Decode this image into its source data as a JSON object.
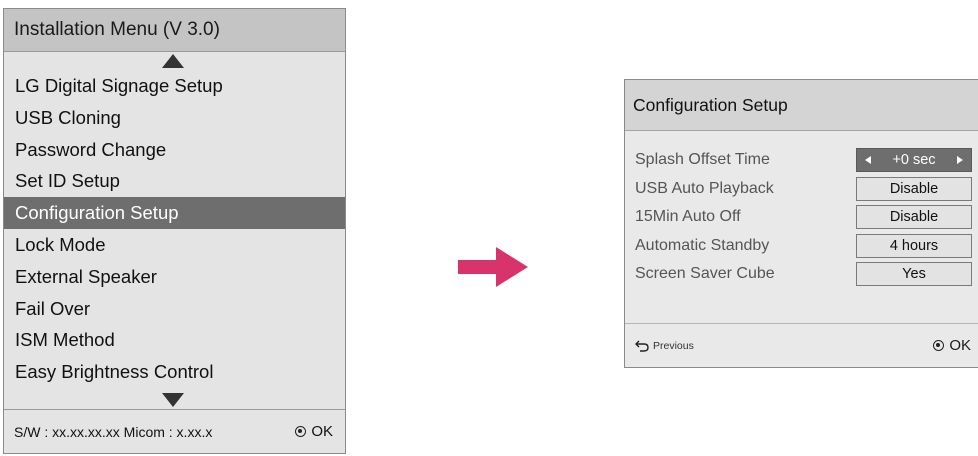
{
  "installation_menu": {
    "title": "Installation Menu (V 3.0)",
    "items": [
      {
        "label": "LG Digital Signage Setup",
        "selected": false
      },
      {
        "label": "USB Cloning",
        "selected": false
      },
      {
        "label": "Password Change",
        "selected": false
      },
      {
        "label": "Set ID Setup",
        "selected": false
      },
      {
        "label": "Configuration Setup",
        "selected": true
      },
      {
        "label": "Lock Mode",
        "selected": false
      },
      {
        "label": "External Speaker",
        "selected": false
      },
      {
        "label": "Fail Over",
        "selected": false
      },
      {
        "label": "ISM Method",
        "selected": false
      },
      {
        "label": "Easy Brightness Control",
        "selected": false
      }
    ],
    "footer": {
      "version_text": "S/W : xx.xx.xx.xx Micom : x.xx.x",
      "ok_label": "OK"
    }
  },
  "arrow_color": "#d9336b",
  "configuration_setup": {
    "title": "Configuration Setup",
    "rows": [
      {
        "label": "Splash Offset Time",
        "value": "+0 sec"
      },
      {
        "label": "USB Auto Playback",
        "value": "Disable"
      },
      {
        "label": "15Min Auto Off",
        "value": "Disable"
      },
      {
        "label": "Automatic Standby",
        "value": "4 hours"
      },
      {
        "label": "Screen Saver Cube",
        "value": "Yes"
      }
    ],
    "footer": {
      "previous_label": "Previous",
      "ok_label": "OK"
    }
  },
  "icons": {
    "scroll_up": "triangle-up-icon",
    "scroll_down": "triangle-down-icon",
    "ok": "ok-circle-icon",
    "back": "back-arrow-icon",
    "value_left": "arrow-left-icon",
    "value_right": "arrow-right-icon"
  }
}
